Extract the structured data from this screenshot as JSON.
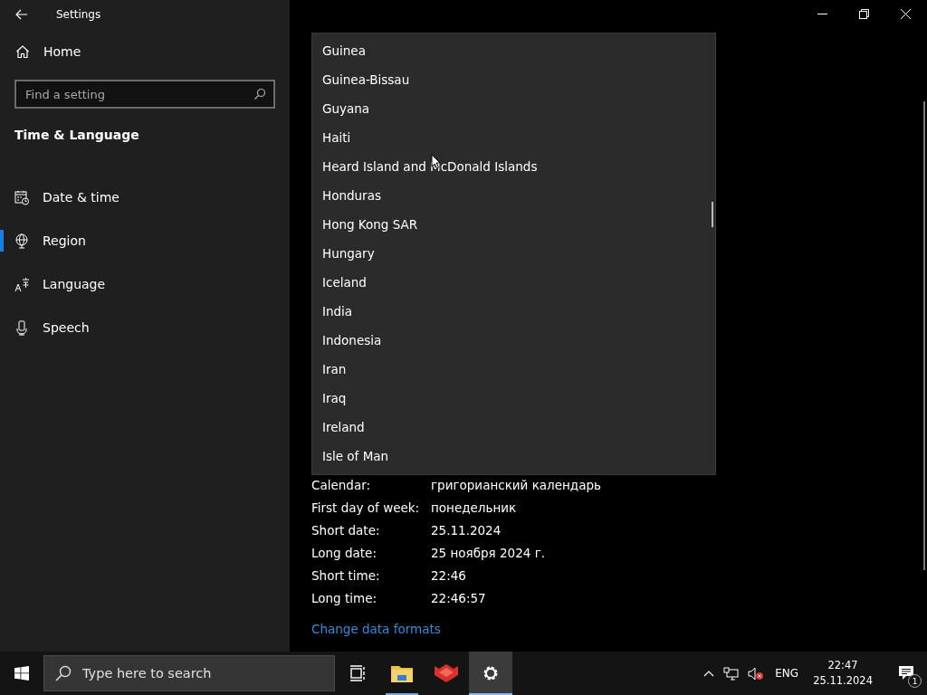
{
  "window": {
    "title": "Settings"
  },
  "sidebar": {
    "home": "Home",
    "search": {
      "placeholder": "Find a setting"
    },
    "section": "Time & Language",
    "items": [
      {
        "kind": "calendar",
        "label": "Date & time",
        "selected": false
      },
      {
        "kind": "globe",
        "label": "Region",
        "selected": true
      },
      {
        "kind": "language",
        "label": "Language",
        "selected": false
      },
      {
        "kind": "mic",
        "label": "Speech",
        "selected": false
      }
    ]
  },
  "dropdown": {
    "options": [
      "Guinea",
      "Guinea-Bissau",
      "Guyana",
      "Haiti",
      "Heard Island and McDonald Islands",
      "Honduras",
      "Hong Kong SAR",
      "Hungary",
      "Iceland",
      "India",
      "Indonesia",
      "Iran",
      "Iraq",
      "Ireland",
      "Isle of Man"
    ]
  },
  "formats": [
    {
      "label": "Calendar:",
      "value": "григорианский календарь"
    },
    {
      "label": "First day of week:",
      "value": "понедельник"
    },
    {
      "label": "Short date:",
      "value": "25.11.2024"
    },
    {
      "label": "Long date:",
      "value": "25 ноября 2024 г."
    },
    {
      "label": "Short time:",
      "value": "22:46"
    },
    {
      "label": "Long time:",
      "value": "22:46:57"
    }
  ],
  "change_link": "Change data formats",
  "taskbar": {
    "search": {
      "placeholder": "Type here to search"
    },
    "apps": [
      {
        "kind": "taskview",
        "running": false,
        "active": false
      },
      {
        "kind": "explorer",
        "running": true,
        "active": false
      },
      {
        "kind": "redapp",
        "running": false,
        "active": false
      },
      {
        "kind": "settings",
        "running": true,
        "active": true
      }
    ],
    "language": "ENG",
    "time": "22:47",
    "date": "25.11.2024",
    "notifications": "1"
  }
}
